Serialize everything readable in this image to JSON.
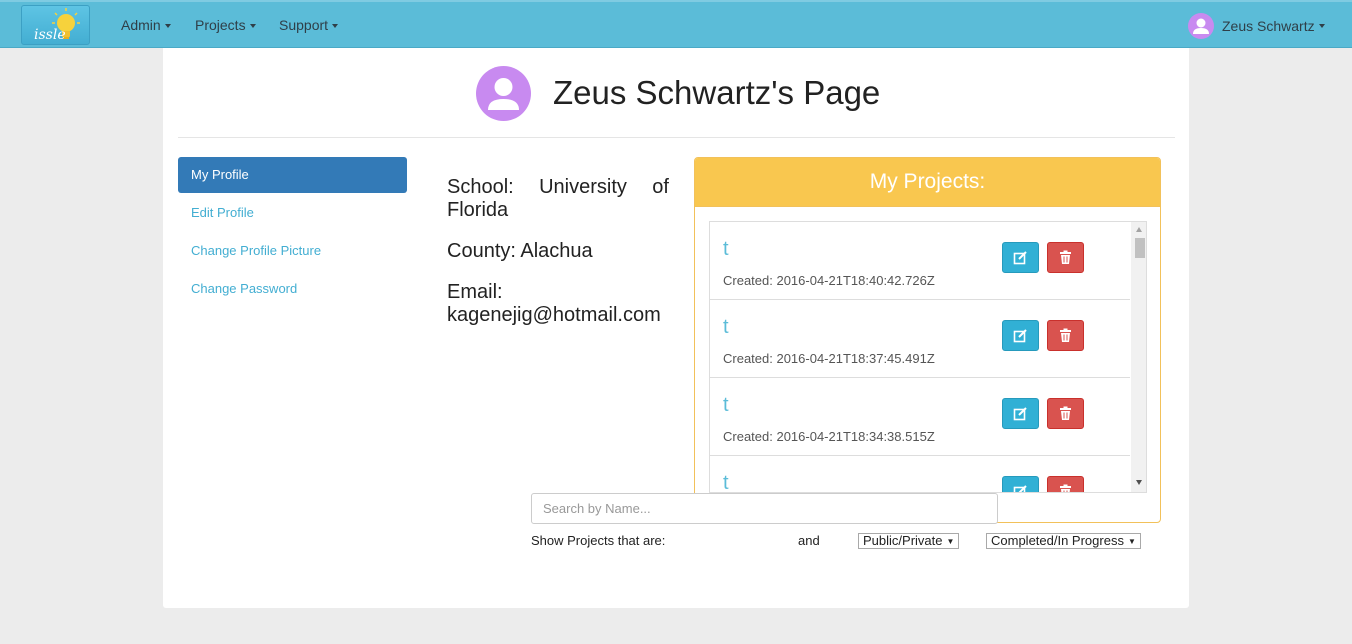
{
  "navbar": {
    "brand_text": "issle",
    "menus": [
      {
        "label": "Admin"
      },
      {
        "label": "Projects"
      },
      {
        "label": "Support"
      }
    ],
    "user_name": "Zeus Schwartz"
  },
  "header": {
    "title": "Zeus Schwartz's Page"
  },
  "sidebar": {
    "items": [
      {
        "label": "My Profile",
        "active": true
      },
      {
        "label": "Edit Profile"
      },
      {
        "label": "Change Profile Picture"
      },
      {
        "label": "Change Password"
      }
    ]
  },
  "profile": {
    "school_line1": "School: University of",
    "school_words": [
      "School:",
      "University",
      "of"
    ],
    "school_line2": "Florida",
    "county": "County: Alachua",
    "email_label": "Email:",
    "email": "kagenejig@hotmail.com"
  },
  "projects_panel": {
    "title": "My Projects:",
    "items": [
      {
        "name": "t",
        "created": "Created: 2016-04-21T18:40:42.726Z"
      },
      {
        "name": "t",
        "created": "Created: 2016-04-21T18:37:45.491Z"
      },
      {
        "name": "t",
        "created": "Created: 2016-04-21T18:34:38.515Z"
      },
      {
        "name": "t",
        "created": ""
      }
    ]
  },
  "search": {
    "placeholder": "Search by Name..."
  },
  "filters": {
    "label": "Show Projects that are:",
    "visibility": "Public/Private",
    "and": "and",
    "status": "Completed/In Progress"
  },
  "colors": {
    "navbar": "#5bbcd8",
    "active_nav": "#337ab7",
    "panel_heading": "#f9c74f",
    "edit_button": "#31b0d5",
    "delete_button": "#d9534f",
    "avatar": "#c88af0"
  }
}
